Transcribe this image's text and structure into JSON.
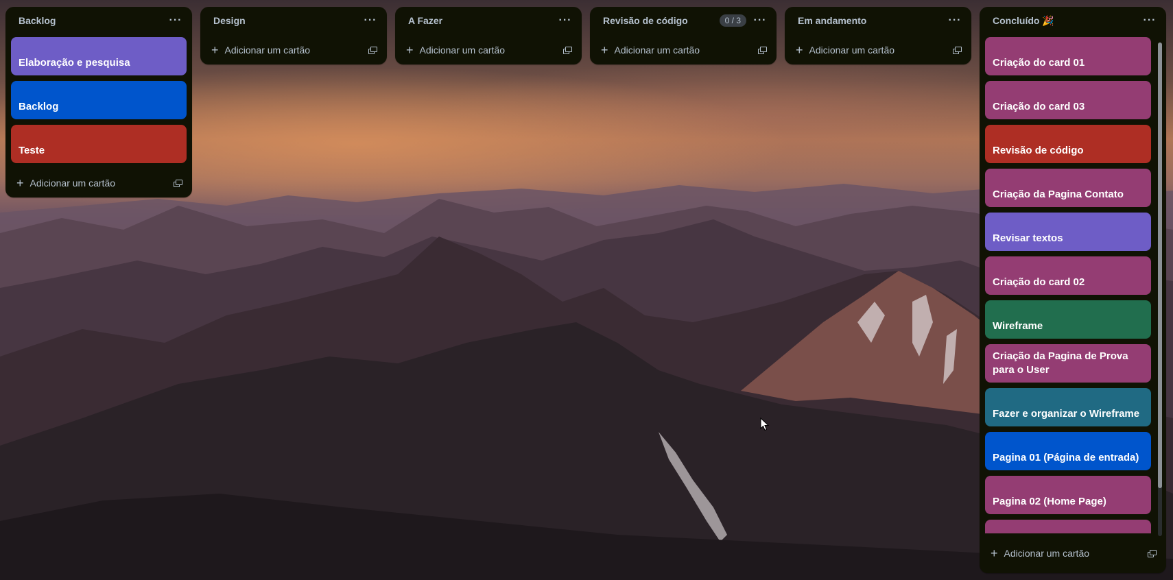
{
  "colors": {
    "list_bg": "#101204",
    "text_muted": "#b6c2cf",
    "purple": "#6e5dc6",
    "blue": "#0055cc",
    "red": "#ae2e24",
    "magenta": "#943d73",
    "green": "#216e4e",
    "teal": "#206a83"
  },
  "icons": {
    "menu": "three-dots-icon",
    "add": "plus-icon",
    "template": "create-from-template-icon"
  },
  "lists": [
    {
      "title": "Backlog",
      "cards": [
        {
          "title": "Elaboração e pesquisa",
          "color": "#6e5dc6"
        },
        {
          "title": "Backlog",
          "color": "#0055cc"
        },
        {
          "title": "Teste",
          "color": "#ae2e24"
        }
      ],
      "add_label": "Adicionar um cartão"
    },
    {
      "title": "Design",
      "cards": [],
      "add_label": "Adicionar um cartão"
    },
    {
      "title": "A Fazer",
      "cards": [],
      "add_label": "Adicionar um cartão"
    },
    {
      "title": "Revisão de código",
      "badge": "0 / 3",
      "cards": [],
      "add_label": "Adicionar um cartão"
    },
    {
      "title": "Em andamento",
      "cards": [],
      "add_label": "Adicionar um cartão"
    },
    {
      "title": "Concluído 🎉",
      "cards": [
        {
          "title": "Criação do card 01",
          "color": "#943d73"
        },
        {
          "title": "Criação do card 03",
          "color": "#943d73"
        },
        {
          "title": "Revisão de código",
          "color": "#ae2e24"
        },
        {
          "title": "Criação da Pagina Contato",
          "color": "#943d73"
        },
        {
          "title": "Revisar textos",
          "color": "#6e5dc6"
        },
        {
          "title": "Criação do card 02",
          "color": "#943d73"
        },
        {
          "title": "Wireframe",
          "color": "#216e4e"
        },
        {
          "title": "Criação da Pagina de Prova para o User",
          "color": "#943d73"
        },
        {
          "title": "Fazer e organizar o Wireframe",
          "color": "#206a83"
        },
        {
          "title": "Pagina 01 (Página de entrada)",
          "color": "#0055cc"
        },
        {
          "title": "Pagina 02 (Home Page)",
          "color": "#943d73"
        },
        {
          "title": "",
          "color": "#943d73"
        }
      ],
      "add_label": "Adicionar um cartão"
    }
  ]
}
